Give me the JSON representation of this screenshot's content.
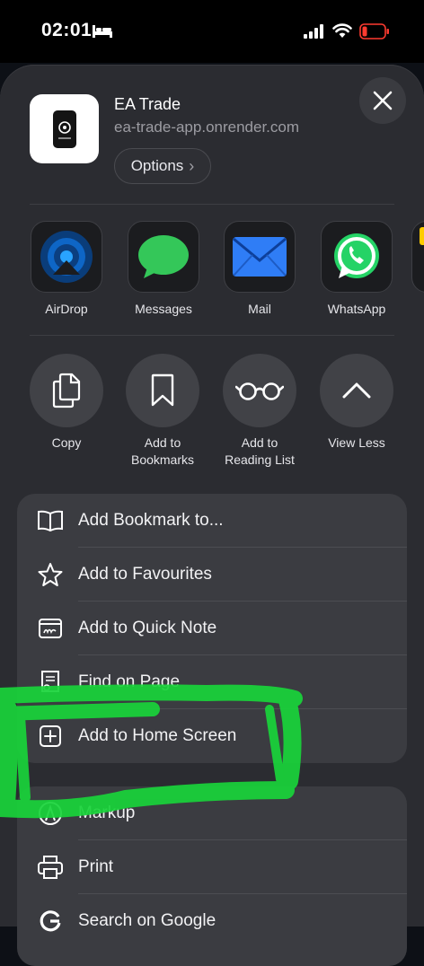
{
  "status": {
    "time": "02:01",
    "icons": [
      "bed-icon",
      "cellular-signal-icon",
      "wifi-icon",
      "battery-low-icon"
    ],
    "battery_color": "#ff3b30"
  },
  "header": {
    "site_name": "EA Trade",
    "site_url": "ea-trade-app.onrender.com",
    "options_label": "Options",
    "options_chevron": "›",
    "close_icon": "close-icon"
  },
  "share_apps": [
    {
      "label": "AirDrop",
      "icon": "airdrop-icon",
      "color": "#1a8cff"
    },
    {
      "label": "Messages",
      "icon": "messages-icon",
      "color": "#34c759"
    },
    {
      "label": "Mail",
      "icon": "mail-icon",
      "color": "#2f7df6"
    },
    {
      "label": "WhatsApp",
      "icon": "whatsapp-icon",
      "color": "#25d366"
    }
  ],
  "actions": [
    {
      "label": "Copy",
      "icon": "copy-icon"
    },
    {
      "label": "Add to\nBookmarks",
      "icon": "bookmark-icon"
    },
    {
      "label": "Add to\nReading List",
      "icon": "glasses-icon"
    },
    {
      "label": "View Less",
      "icon": "chevron-up-icon"
    }
  ],
  "menu_group_1": [
    {
      "label": "Add Bookmark to...",
      "icon": "book-icon"
    },
    {
      "label": "Add to Favourites",
      "icon": "star-icon"
    },
    {
      "label": "Add to Quick Note",
      "icon": "quick-note-icon"
    },
    {
      "label": "Find on Page",
      "icon": "find-on-page-icon"
    },
    {
      "label": "Add to Home Screen",
      "icon": "add-square-icon"
    }
  ],
  "menu_group_2": [
    {
      "label": "Markup",
      "icon": "markup-icon"
    },
    {
      "label": "Print",
      "icon": "printer-icon"
    },
    {
      "label": "Search on Google",
      "icon": "google-icon"
    }
  ],
  "annotation": {
    "color": "#19d43a",
    "target": "Add to Home Screen"
  }
}
